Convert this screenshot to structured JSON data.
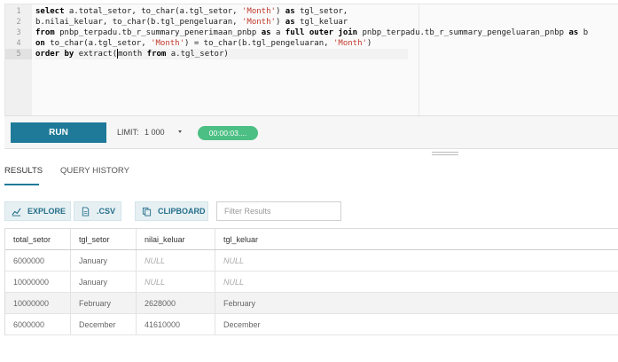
{
  "editor": {
    "line_numbers": [
      "1",
      "2",
      "3",
      "4",
      "5"
    ],
    "lines": [
      [
        {
          "t": "select",
          "k": "kw"
        },
        {
          "t": " a.total_setor, to_char(a.tgl_setor, "
        },
        {
          "t": "'Month'",
          "k": "str"
        },
        {
          "t": ") "
        },
        {
          "t": "as",
          "k": "kw"
        },
        {
          "t": " tgl_setor,"
        }
      ],
      [
        {
          "t": "b.nilai_keluar, to_char(b.tgl_pengeluaran, "
        },
        {
          "t": "'Month'",
          "k": "str"
        },
        {
          "t": ") "
        },
        {
          "t": "as",
          "k": "kw"
        },
        {
          "t": " tgl_keluar"
        }
      ],
      [
        {
          "t": "from",
          "k": "kw"
        },
        {
          "t": " pnbp_terpadu.tb_r_summary_penerimaan_pnbp "
        },
        {
          "t": "as",
          "k": "kw"
        },
        {
          "t": " a "
        },
        {
          "t": "full outer join",
          "k": "kw"
        },
        {
          "t": " pnbp_terpadu.tb_r_summary_pengeluaran_pnbp "
        },
        {
          "t": "as",
          "k": "kw"
        },
        {
          "t": " b"
        }
      ],
      [
        {
          "t": "on",
          "k": "kw"
        },
        {
          "t": " to_char(a.tgl_setor, "
        },
        {
          "t": "'Month'",
          "k": "str"
        },
        {
          "t": ") = to_char(b.tgl_pengeluaran, "
        },
        {
          "t": "'Month'",
          "k": "str"
        },
        {
          "t": ")"
        }
      ],
      [
        {
          "t": "order by",
          "k": "kw"
        },
        {
          "t": " extract"
        },
        {
          "t": "(",
          "k": "cur"
        },
        {
          "t": "month "
        },
        {
          "t": "from",
          "k": "kw"
        },
        {
          "t": " a.tgl_setor)"
        }
      ]
    ],
    "active_line": 5
  },
  "toolbar": {
    "run_label": "RUN",
    "limit_label": "LIMIT:",
    "limit_value": "1 000",
    "timer": "00:00:03...."
  },
  "tabs": {
    "results": "RESULTS",
    "history": "QUERY HISTORY"
  },
  "actions": {
    "explore": "EXPLORE",
    "csv": ".CSV",
    "clipboard": "CLIPBOARD",
    "filter_placeholder": "Filter Results"
  },
  "colors": {
    "accent": "#1f7a99",
    "timer": "#4cbf84"
  },
  "table": {
    "columns": [
      "total_setor",
      "tgl_setor",
      "nilai_keluar",
      "tgl_keluar"
    ],
    "rows": [
      [
        "6000000",
        "January",
        "NULL",
        "NULL"
      ],
      [
        "10000000",
        "January",
        "NULL",
        "NULL"
      ],
      [
        "10000000",
        "February",
        "2628000",
        "February"
      ],
      [
        "6000000",
        "December",
        "41610000",
        "December"
      ]
    ]
  }
}
